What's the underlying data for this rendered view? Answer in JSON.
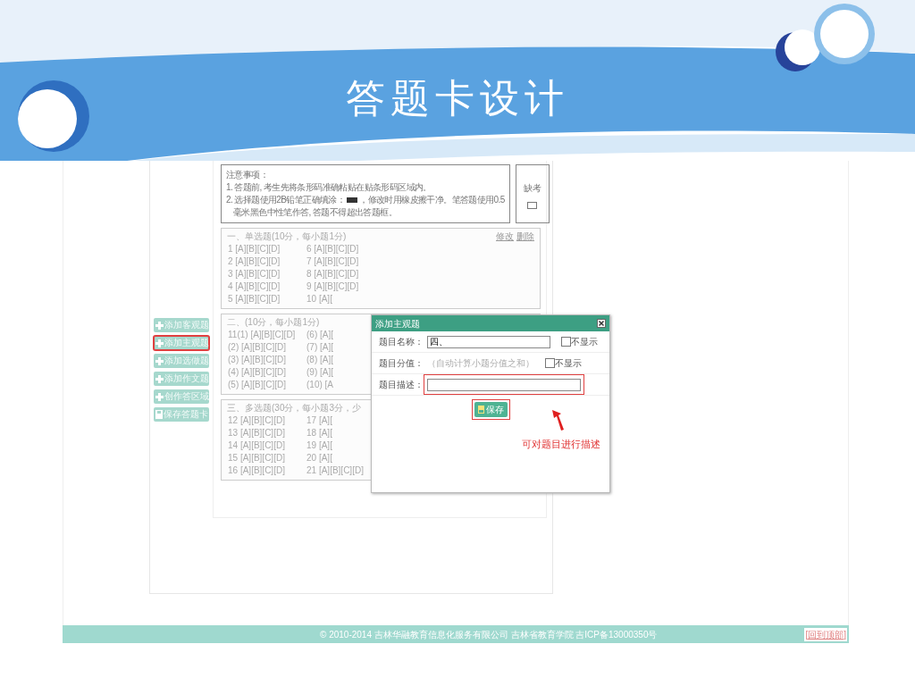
{
  "slide": {
    "title": "答题卡设计"
  },
  "sidebar": {
    "buttons": [
      {
        "label": "添加客观题",
        "kind": "add",
        "highlighted": false
      },
      {
        "label": "添加主观题",
        "kind": "add",
        "highlighted": true
      },
      {
        "label": "添加选做题",
        "kind": "add",
        "highlighted": false
      },
      {
        "label": "添加作文题",
        "kind": "add",
        "highlighted": false
      },
      {
        "label": "创作答区域",
        "kind": "add",
        "highlighted": false
      },
      {
        "label": "保存答题卡",
        "kind": "save",
        "highlighted": false
      }
    ]
  },
  "notes": {
    "heading": "注意事项：",
    "lines": [
      {
        "kind": "text",
        "text": "1. 答题前, 考生先将条形码准确粘贴在贴条形码区域内。"
      },
      {
        "kind": "mark",
        "before": "2. 选择题使用2B铅笔正确填涂：",
        "after": "，修改时用橡皮擦干净。笔答题使用0.5",
        "continuation": "毫米黑色中性笔作答, 答题不得超出答题框。"
      }
    ]
  },
  "absent": {
    "label": "缺考",
    "checked": false
  },
  "sections": [
    {
      "title": "一、单选题(10分，每小题1分)",
      "actions": [
        "修改",
        "删除"
      ],
      "columns": [
        [
          "1 [A][B][C][D]",
          "2 [A][B][C][D]",
          "3 [A][B][C][D]",
          "4 [A][B][C][D]",
          "5 [A][B][C][D]"
        ],
        [
          "6 [A][B][C][D]",
          "7 [A][B][C][D]",
          "8 [A][B][C][D]",
          "9 [A][B][C][D]",
          "10 [A]["
        ]
      ]
    },
    {
      "title": "二、(10分，每小题1分)",
      "columns": [
        [
          "11(1) [A][B][C][D]",
          "(2) [A][B][C][D]",
          "(3) [A][B][C][D]",
          "(4) [A][B][C][D]",
          "(5) [A][B][C][D]"
        ],
        [
          "(6) [A][",
          "(7) [A][",
          "(8) [A][",
          "(9) [A][",
          "(10) [A"
        ]
      ]
    },
    {
      "title": "三、多选题(30分，每小题3分，少",
      "columns": [
        [
          "12 [A][B][C][D]",
          "13 [A][B][C][D]",
          "14 [A][B][C][D]",
          "15 [A][B][C][D]",
          "16 [A][B][C][D]"
        ],
        [
          "17 [A][",
          "18 [A][",
          "19 [A][",
          "20 [A][",
          "21 [A][B][C][D]"
        ]
      ]
    }
  ],
  "dialog": {
    "title": "添加主观题",
    "fields": [
      {
        "label": "题目名称：",
        "kind": "input",
        "value": "四、",
        "hide_label": "不显示",
        "hide_checked": false,
        "highlighted": false
      },
      {
        "label": "题目分值：",
        "kind": "text",
        "value": "（自动计算小题分值之和）",
        "hide_label": "不显示",
        "hide_checked": false,
        "highlighted": false
      },
      {
        "label": "题目描述：",
        "kind": "input",
        "highlighted": true
      }
    ],
    "save": {
      "label": "保存",
      "highlighted": true
    },
    "annotation": "可对题目进行描述"
  },
  "footer": {
    "copyright": "© 2010-2014 吉林华融教育信息化服务有限公司  吉林省教育学院  吉ICP备13000350号",
    "back_to_top": "[回到顶部]"
  }
}
